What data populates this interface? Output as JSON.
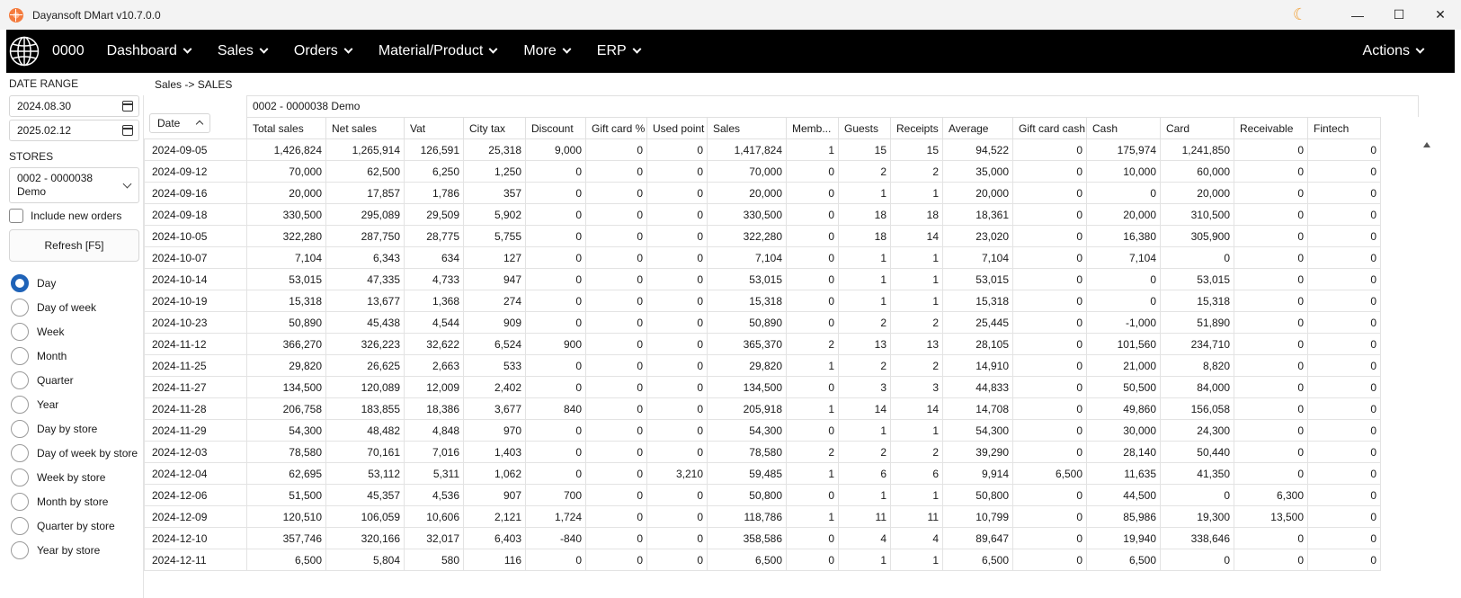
{
  "window": {
    "title": "Dayansoft DMart v10.7.0.0",
    "controls": {
      "minimize": "—",
      "maximize": "☐",
      "close": "✕"
    }
  },
  "menubar": {
    "store_code": "0000",
    "items": [
      "Dashboard",
      "Sales",
      "Orders",
      "Material/Product",
      "More",
      "ERP"
    ],
    "actions": "Actions"
  },
  "sidebar": {
    "date_range_label": "DATE RANGE",
    "date_from": "2024.08.30",
    "date_to": "2025.02.12",
    "stores_label": "STORES",
    "store_selected": "0002 - 0000038 Demo",
    "include_new_orders": "Include new orders",
    "refresh_button": "Refresh [F5]",
    "grouping": [
      {
        "label": "Day",
        "checked": true
      },
      {
        "label": "Day of week",
        "checked": false
      },
      {
        "label": "Week",
        "checked": false
      },
      {
        "label": "Month",
        "checked": false
      },
      {
        "label": "Quarter",
        "checked": false
      },
      {
        "label": "Year",
        "checked": false
      },
      {
        "label": "Day by store",
        "checked": false
      },
      {
        "label": "Day of week by store",
        "checked": false
      },
      {
        "label": "Week by store",
        "checked": false
      },
      {
        "label": "Month by store",
        "checked": false
      },
      {
        "label": "Quarter by store",
        "checked": false
      },
      {
        "label": "Year by store",
        "checked": false
      }
    ]
  },
  "main": {
    "breadcrumb": "Sales -> SALES",
    "store_header": "0002 - 0000038 Demo",
    "date_column": "Date",
    "columns": [
      "Total sales",
      "Net sales",
      "Vat",
      "City tax",
      "Discount",
      "Gift card %",
      "Used point",
      "Sales",
      "Memb...",
      "Guests",
      "Receipts",
      "Average",
      "Gift card cash",
      "Cash",
      "Card",
      "Receivable",
      "Fintech"
    ],
    "rows": [
      [
        "2024-09-05",
        "1,426,824",
        "1,265,914",
        "126,591",
        "25,318",
        "9,000",
        "0",
        "0",
        "1,417,824",
        "1",
        "15",
        "15",
        "94,522",
        "0",
        "175,974",
        "1,241,850",
        "0",
        "0"
      ],
      [
        "2024-09-12",
        "70,000",
        "62,500",
        "6,250",
        "1,250",
        "0",
        "0",
        "0",
        "70,000",
        "0",
        "2",
        "2",
        "35,000",
        "0",
        "10,000",
        "60,000",
        "0",
        "0"
      ],
      [
        "2024-09-16",
        "20,000",
        "17,857",
        "1,786",
        "357",
        "0",
        "0",
        "0",
        "20,000",
        "0",
        "1",
        "1",
        "20,000",
        "0",
        "0",
        "20,000",
        "0",
        "0"
      ],
      [
        "2024-09-18",
        "330,500",
        "295,089",
        "29,509",
        "5,902",
        "0",
        "0",
        "0",
        "330,500",
        "0",
        "18",
        "18",
        "18,361",
        "0",
        "20,000",
        "310,500",
        "0",
        "0"
      ],
      [
        "2024-10-05",
        "322,280",
        "287,750",
        "28,775",
        "5,755",
        "0",
        "0",
        "0",
        "322,280",
        "0",
        "18",
        "14",
        "23,020",
        "0",
        "16,380",
        "305,900",
        "0",
        "0"
      ],
      [
        "2024-10-07",
        "7,104",
        "6,343",
        "634",
        "127",
        "0",
        "0",
        "0",
        "7,104",
        "0",
        "1",
        "1",
        "7,104",
        "0",
        "7,104",
        "0",
        "0",
        "0"
      ],
      [
        "2024-10-14",
        "53,015",
        "47,335",
        "4,733",
        "947",
        "0",
        "0",
        "0",
        "53,015",
        "0",
        "1",
        "1",
        "53,015",
        "0",
        "0",
        "53,015",
        "0",
        "0"
      ],
      [
        "2024-10-19",
        "15,318",
        "13,677",
        "1,368",
        "274",
        "0",
        "0",
        "0",
        "15,318",
        "0",
        "1",
        "1",
        "15,318",
        "0",
        "0",
        "15,318",
        "0",
        "0"
      ],
      [
        "2024-10-23",
        "50,890",
        "45,438",
        "4,544",
        "909",
        "0",
        "0",
        "0",
        "50,890",
        "0",
        "2",
        "2",
        "25,445",
        "0",
        "-1,000",
        "51,890",
        "0",
        "0"
      ],
      [
        "2024-11-12",
        "366,270",
        "326,223",
        "32,622",
        "6,524",
        "900",
        "0",
        "0",
        "365,370",
        "2",
        "13",
        "13",
        "28,105",
        "0",
        "101,560",
        "234,710",
        "0",
        "0"
      ],
      [
        "2024-11-25",
        "29,820",
        "26,625",
        "2,663",
        "533",
        "0",
        "0",
        "0",
        "29,820",
        "1",
        "2",
        "2",
        "14,910",
        "0",
        "21,000",
        "8,820",
        "0",
        "0"
      ],
      [
        "2024-11-27",
        "134,500",
        "120,089",
        "12,009",
        "2,402",
        "0",
        "0",
        "0",
        "134,500",
        "0",
        "3",
        "3",
        "44,833",
        "0",
        "50,500",
        "84,000",
        "0",
        "0"
      ],
      [
        "2024-11-28",
        "206,758",
        "183,855",
        "18,386",
        "3,677",
        "840",
        "0",
        "0",
        "205,918",
        "1",
        "14",
        "14",
        "14,708",
        "0",
        "49,860",
        "156,058",
        "0",
        "0"
      ],
      [
        "2024-11-29",
        "54,300",
        "48,482",
        "4,848",
        "970",
        "0",
        "0",
        "0",
        "54,300",
        "0",
        "1",
        "1",
        "54,300",
        "0",
        "30,000",
        "24,300",
        "0",
        "0"
      ],
      [
        "2024-12-03",
        "78,580",
        "70,161",
        "7,016",
        "1,403",
        "0",
        "0",
        "0",
        "78,580",
        "2",
        "2",
        "2",
        "39,290",
        "0",
        "28,140",
        "50,440",
        "0",
        "0"
      ],
      [
        "2024-12-04",
        "62,695",
        "53,112",
        "5,311",
        "1,062",
        "0",
        "0",
        "3,210",
        "59,485",
        "1",
        "6",
        "6",
        "9,914",
        "6,500",
        "11,635",
        "41,350",
        "0",
        "0"
      ],
      [
        "2024-12-06",
        "51,500",
        "45,357",
        "4,536",
        "907",
        "700",
        "0",
        "0",
        "50,800",
        "0",
        "1",
        "1",
        "50,800",
        "0",
        "44,500",
        "0",
        "6,300",
        "0"
      ],
      [
        "2024-12-09",
        "120,510",
        "106,059",
        "10,606",
        "2,121",
        "1,724",
        "0",
        "0",
        "118,786",
        "1",
        "11",
        "11",
        "10,799",
        "0",
        "85,986",
        "19,300",
        "13,500",
        "0"
      ],
      [
        "2024-12-10",
        "357,746",
        "320,166",
        "32,017",
        "6,403",
        "-840",
        "0",
        "0",
        "358,586",
        "0",
        "4",
        "4",
        "89,647",
        "0",
        "19,940",
        "338,646",
        "0",
        "0"
      ],
      [
        "2024-12-11",
        "6,500",
        "5,804",
        "580",
        "116",
        "0",
        "0",
        "0",
        "6,500",
        "0",
        "1",
        "1",
        "6,500",
        "0",
        "6,500",
        "0",
        "0",
        "0"
      ]
    ]
  },
  "colors": {
    "menubar_bg": "#000000",
    "radio_accent": "#1f63b8",
    "moon_icon": "#f2a23a"
  }
}
